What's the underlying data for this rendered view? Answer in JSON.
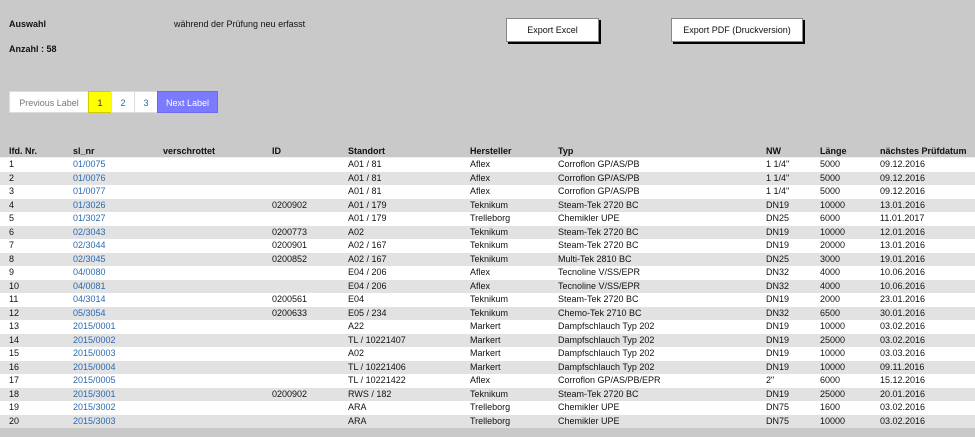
{
  "header": {
    "auswahl_label": "Auswahl",
    "filter_text": "während der Prüfung neu erfasst",
    "anzahl_label": "Anzahl : 58"
  },
  "buttons": {
    "export_excel": "Export Excel",
    "export_pdf": "Export PDF (Druckversion)"
  },
  "pager": {
    "previous": "Previous Label",
    "pages": [
      "1",
      "2",
      "3"
    ],
    "active_page": "1",
    "next": "Next Label"
  },
  "table": {
    "columns": [
      "lfd. Nr.",
      "sl_nr",
      "verschrottet",
      "ID",
      "Standort",
      "Hersteller",
      "Typ",
      "NW",
      "Länge",
      "nächstes Prüfdatum"
    ],
    "rows": [
      [
        "1",
        "01/0075",
        "",
        "",
        "A01 / 81",
        "Aflex",
        "Corroflon GP/AS/PB",
        "1 1/4\"",
        "5000",
        "09.12.2016"
      ],
      [
        "2",
        "01/0076",
        "",
        "",
        "A01 / 81",
        "Aflex",
        "Corroflon GP/AS/PB",
        "1 1/4\"",
        "5000",
        "09.12.2016"
      ],
      [
        "3",
        "01/0077",
        "",
        "",
        "A01 / 81",
        "Aflex",
        "Corroflon GP/AS/PB",
        "1 1/4\"",
        "5000",
        "09.12.2016"
      ],
      [
        "4",
        "01/3026",
        "",
        "0200902",
        "A01 / 179",
        "Teknikum",
        "Steam-Tek 2720 BC",
        "DN19",
        "10000",
        "13.01.2016"
      ],
      [
        "5",
        "01/3027",
        "",
        "",
        "A01 / 179",
        "Trelleborg",
        "Chemikler UPE",
        "DN25",
        "6000",
        "11.01.2017"
      ],
      [
        "6",
        "02/3043",
        "",
        "0200773",
        "A02",
        "Teknikum",
        "Steam-Tek 2720 BC",
        "DN19",
        "10000",
        "12.01.2016"
      ],
      [
        "7",
        "02/3044",
        "",
        "0200901",
        "A02 / 167",
        "Teknikum",
        "Steam-Tek 2720 BC",
        "DN19",
        "20000",
        "13.01.2016"
      ],
      [
        "8",
        "02/3045",
        "",
        "0200852",
        "A02 / 167",
        "Teknikum",
        "Multi-Tek 2810 BC",
        "DN25",
        "3000",
        "19.01.2016"
      ],
      [
        "9",
        "04/0080",
        "",
        "",
        "E04 / 206",
        "Aflex",
        "Tecnoline V/SS/EPR",
        "DN32",
        "4000",
        "10.06.2016"
      ],
      [
        "10",
        "04/0081",
        "",
        "",
        "E04 / 206",
        "Aflex",
        "Tecnoline V/SS/EPR",
        "DN32",
        "4000",
        "10.06.2016"
      ],
      [
        "11",
        "04/3014",
        "",
        "0200561",
        "E04",
        "Teknikum",
        "Steam-Tek 2720 BC",
        "DN19",
        "2000",
        "23.01.2016"
      ],
      [
        "12",
        "05/3054",
        "",
        "0200633",
        "E05 / 234",
        "Teknikum",
        "Chemo-Tek 2710 BC",
        "DN32",
        "6500",
        "30.01.2016"
      ],
      [
        "13",
        "2015/0001",
        "",
        "",
        "A22",
        "Markert",
        "Dampfschlauch Typ 202",
        "DN19",
        "10000",
        "03.02.2016"
      ],
      [
        "14",
        "2015/0002",
        "",
        "",
        "TL / 10221407",
        "Markert",
        "Dampfschlauch Typ 202",
        "DN19",
        "25000",
        "03.02.2016"
      ],
      [
        "15",
        "2015/0003",
        "",
        "",
        "A02",
        "Markert",
        "Dampfschlauch Typ 202",
        "DN19",
        "10000",
        "03.03.2016"
      ],
      [
        "16",
        "2015/0004",
        "",
        "",
        "TL / 10221406",
        "Markert",
        "Dampfschlauch Typ 202",
        "DN19",
        "10000",
        "09.11.2016"
      ],
      [
        "17",
        "2015/0005",
        "",
        "",
        "TL / 10221422",
        "Aflex",
        "Corroflon GP/AS/PB/EPR",
        "2\"",
        "6000",
        "15.12.2016"
      ],
      [
        "18",
        "2015/3001",
        "",
        "0200902",
        "RWS / 182",
        "Teknikum",
        "Steam-Tek 2720 BC",
        "DN19",
        "25000",
        "20.01.2016"
      ],
      [
        "19",
        "2015/3002",
        "",
        "",
        "ARA",
        "Trelleborg",
        "Chemikler UPE",
        "DN75",
        "1600",
        "03.02.2016"
      ],
      [
        "20",
        "2015/3003",
        "",
        "",
        "ARA",
        "Trelleborg",
        "Chemikler UPE",
        "DN75",
        "10000",
        "03.02.2016"
      ]
    ]
  }
}
